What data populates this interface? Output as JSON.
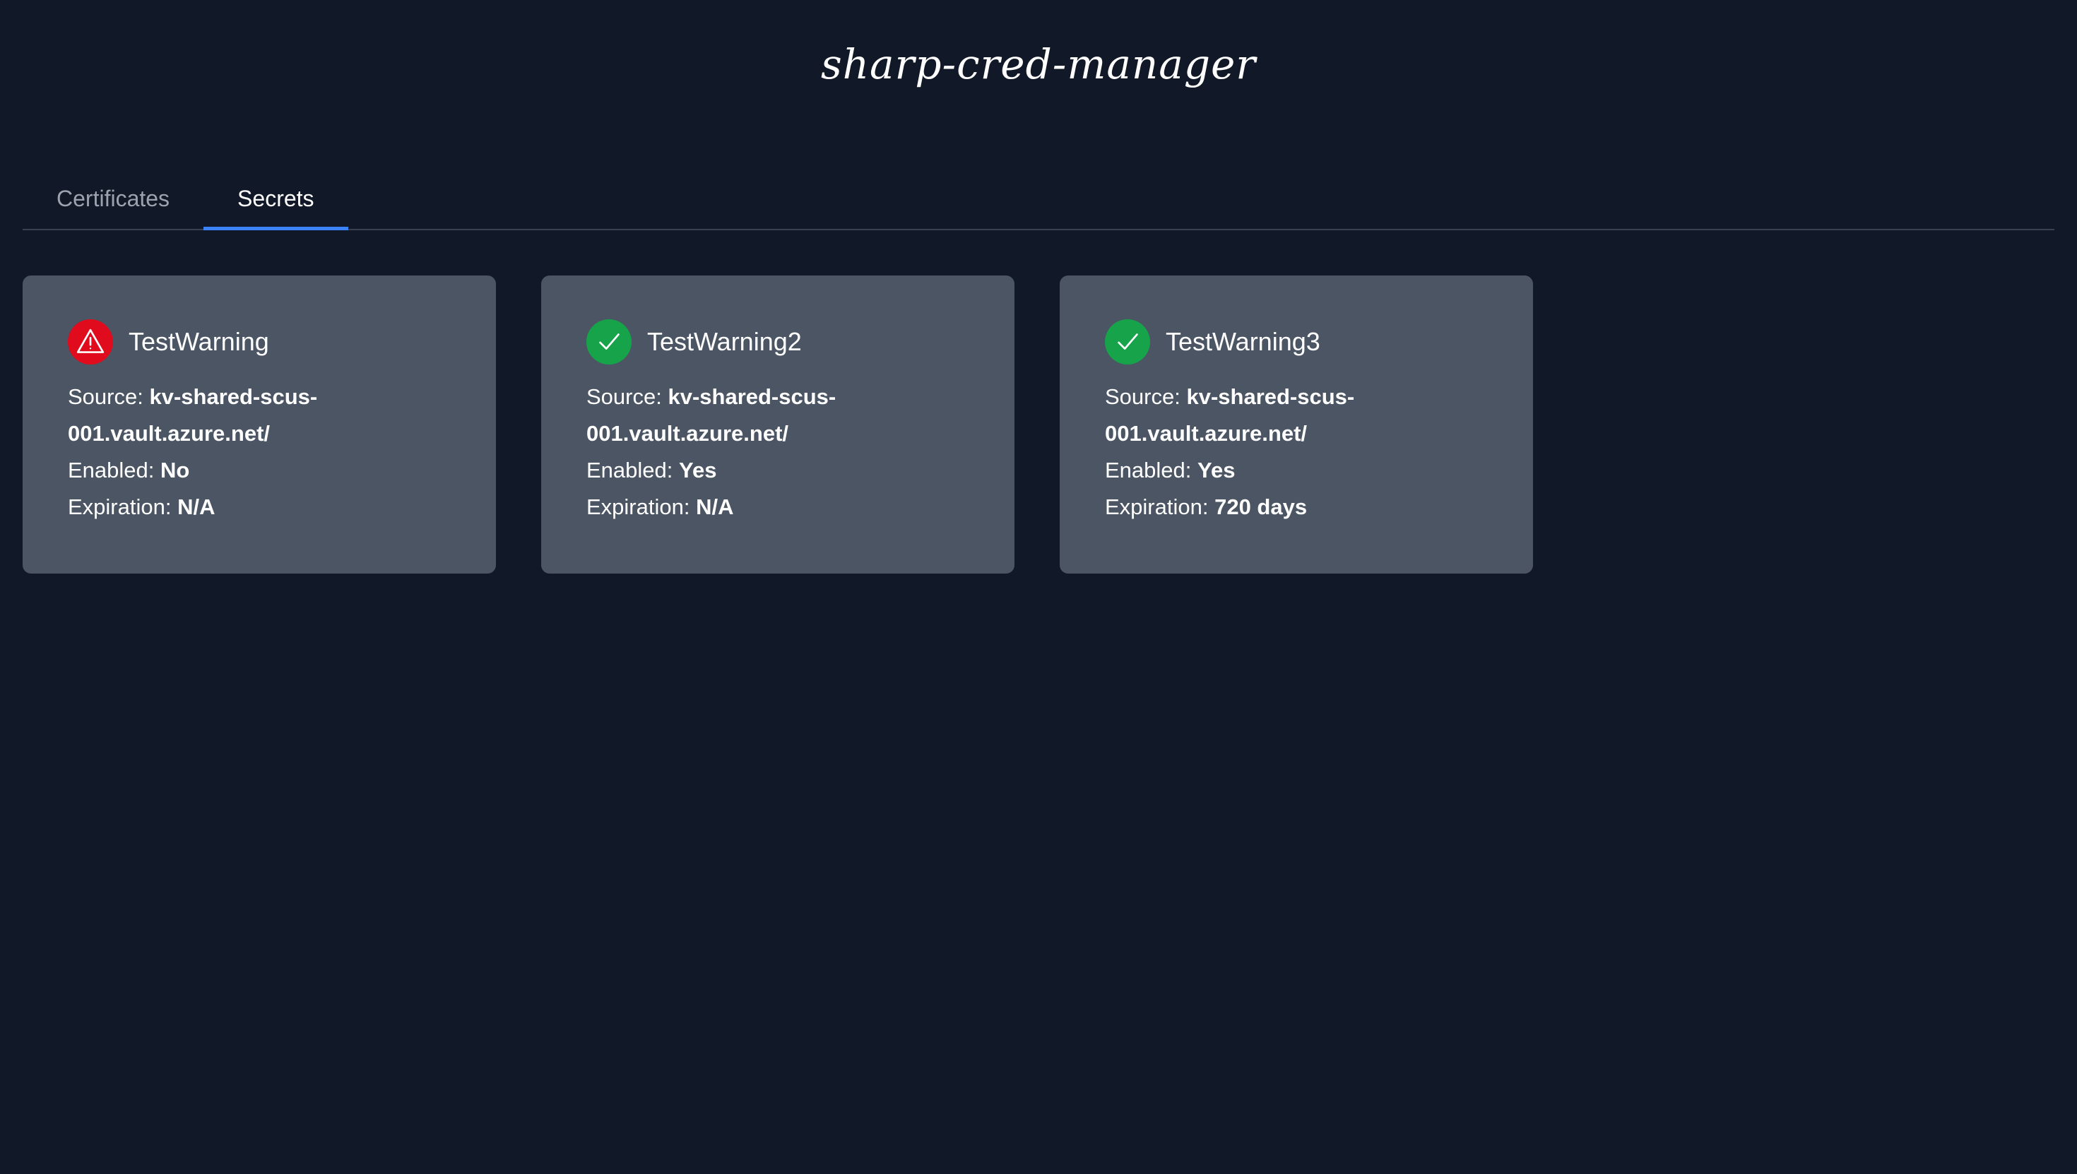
{
  "app": {
    "title": "sharp-cred-manager"
  },
  "tabs": [
    {
      "label": "Certificates",
      "active": false
    },
    {
      "label": "Secrets",
      "active": true
    }
  ],
  "labels": {
    "source": "Source:",
    "enabled": "Enabled:",
    "expiration": "Expiration:"
  },
  "colors": {
    "warning": "#e00b1c",
    "ok": "#16a34a",
    "accent": "#3b82f6"
  },
  "cards": [
    {
      "title": "TestWarning",
      "status_icon": "warning-triangle-icon",
      "source_line1": "kv-shared-scus-",
      "source_line2": "001.vault.azure.net/",
      "enabled": "No",
      "expiration": "N/A"
    },
    {
      "title": "TestWarning2",
      "status_icon": "check-icon",
      "source_line1": "kv-shared-scus-",
      "source_line2": "001.vault.azure.net/",
      "enabled": "Yes",
      "expiration": "N/A"
    },
    {
      "title": "TestWarning3",
      "status_icon": "check-icon",
      "source_line1": "kv-shared-scus-",
      "source_line2": "001.vault.azure.net/",
      "enabled": "Yes",
      "expiration": "720 days"
    }
  ]
}
